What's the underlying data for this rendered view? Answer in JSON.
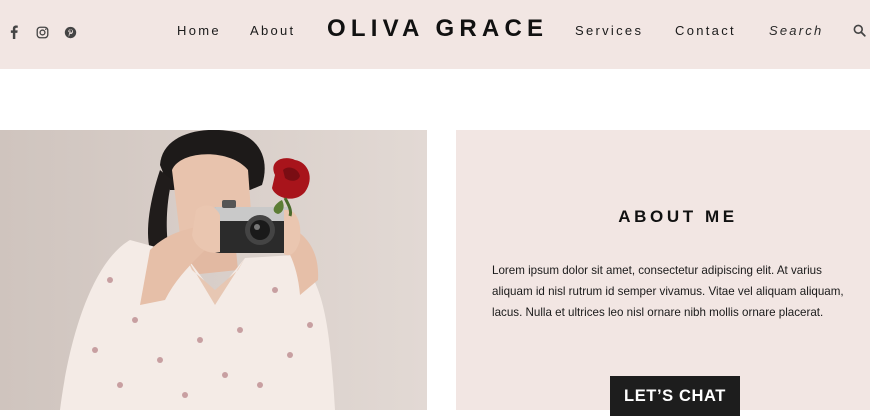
{
  "header": {
    "brand": "OLIVA GRACE",
    "nav_left": [
      "Home",
      "About"
    ],
    "nav_right": [
      "Services",
      "Contact"
    ],
    "search_placeholder": "Search",
    "socials": [
      "facebook-icon",
      "instagram-icon",
      "pinterest-icon"
    ],
    "icon_color": "#444444"
  },
  "about": {
    "title": "ABOUT ME",
    "body": "Lorem ipsum dolor sit amet, consectetur adipiscing elit. At varius aliquam id nisl rutrum id semper vivamus. Vitae vel aliquam aliquam, lacus. Nulla et ultrices leo nisl ornare nibh mollis ornare placerat.",
    "cta_label": "LET’S CHAT"
  },
  "colors": {
    "header_bg": "#f2e6e3",
    "panel_bg": "#f2e6e3",
    "button_bg": "#1d1d1d",
    "button_text": "#ffffff"
  }
}
